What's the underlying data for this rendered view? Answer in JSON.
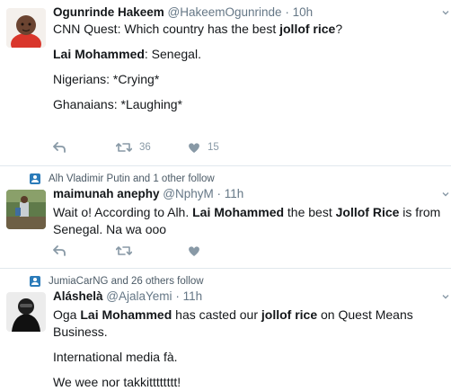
{
  "tweets": [
    {
      "author_name": "Ogunrinde Hakeem",
      "handle": "@HakeemOgunrinde",
      "separator": "·",
      "time": "10h",
      "line1_a": "CNN Quest: Which country has the best ",
      "line1_b": "jollof rice",
      "line1_c": "?",
      "line2_a": "Lai Mohammed",
      "line2_b": ": Senegal.",
      "line3": "Nigerians: *Crying*",
      "line4": "Ghanaians: *Laughing*",
      "retweets": "36",
      "likes": "15"
    },
    {
      "context": "Alh Vladimir Putin and 1 other follow",
      "author_name": "maimunah anephy",
      "handle": "@NphyM",
      "separator": "·",
      "time": "11h",
      "line1_a": "Wait o! According to Alh. ",
      "line1_b": "Lai Mohammed",
      "line1_c": " the best ",
      "line1_d": "Jollof Rice",
      "line1_e": " is from",
      "line2": "Senegal.  Na wa ooo"
    },
    {
      "context": "JumiaCarNG and 26 others follow",
      "author_name": "Aláshelà",
      "handle": "@AjalaYemi",
      "separator": "·",
      "time": "11h",
      "line1_a": "Oga ",
      "line1_b": "Lai Mohammed",
      "line1_c": " has casted our ",
      "line1_d": "jollof rice",
      "line1_e": " on Quest Means Business.",
      "line2": "International media fà.",
      "line3": "We wee nor takkitttttttt!"
    }
  ],
  "colors": {
    "icon": "#8899a6",
    "context_badge": "#2b7bb9",
    "divider": "#e1e8ed"
  }
}
